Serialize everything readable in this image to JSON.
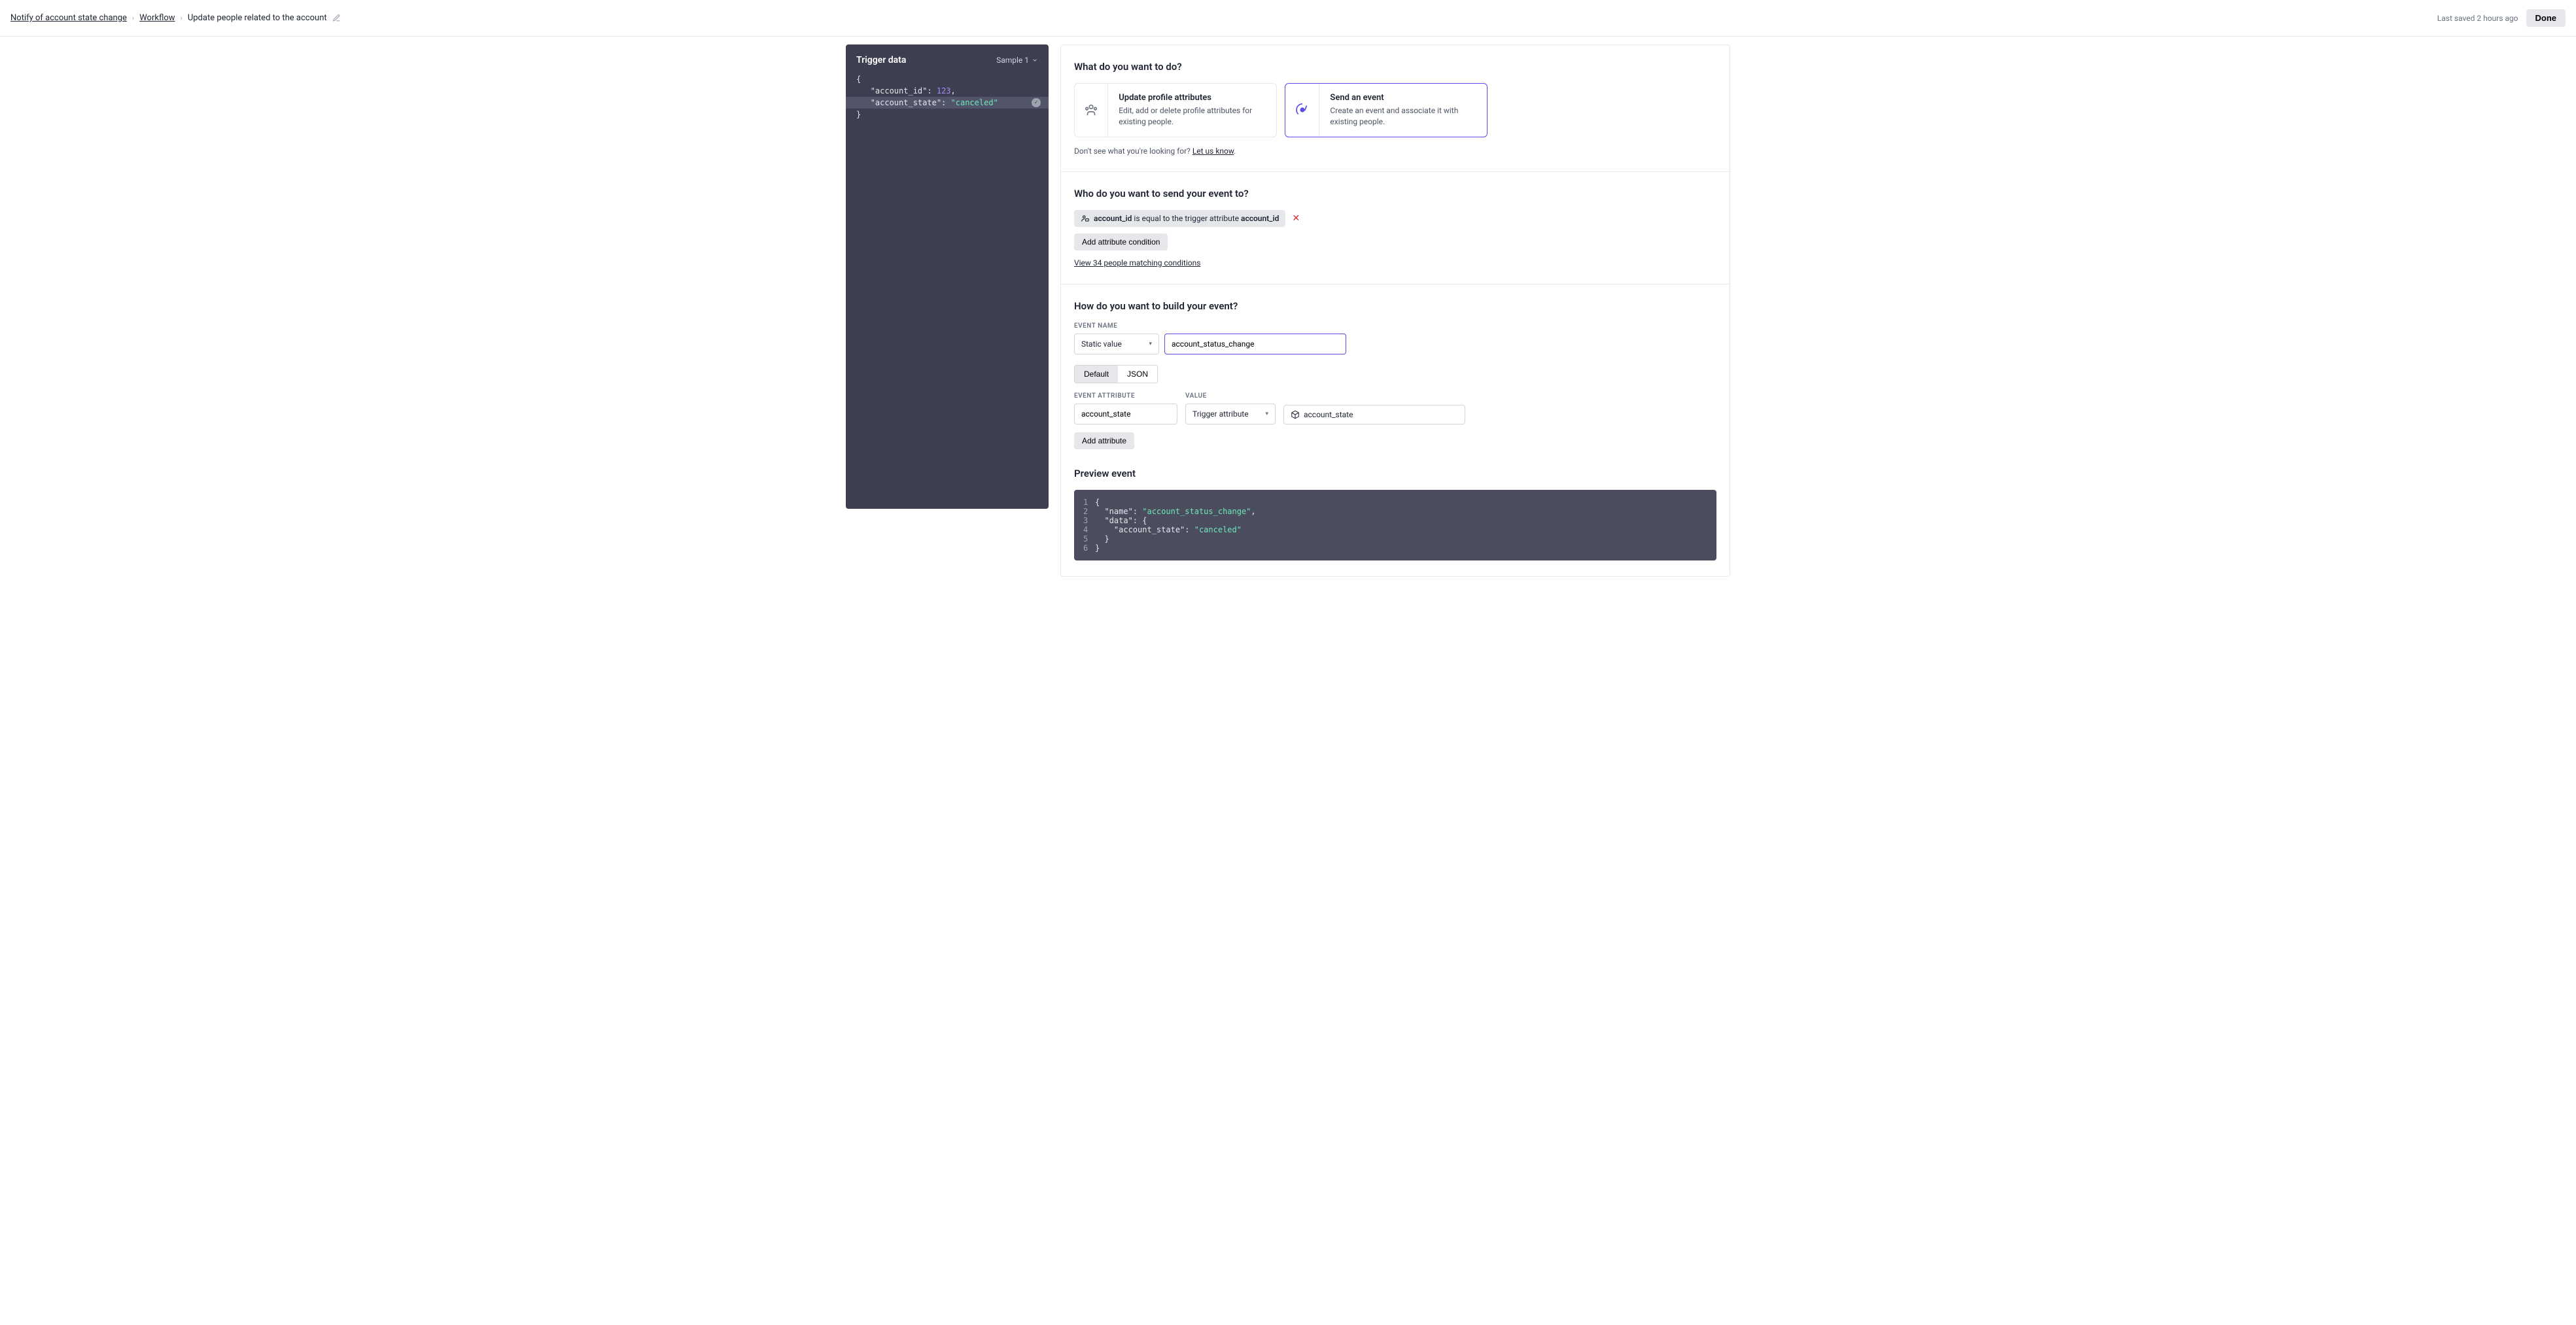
{
  "header": {
    "breadcrumb": [
      "Notify of account state change",
      "Workflow",
      "Update people related to the account"
    ],
    "saved": "Last saved 2 hours ago",
    "done": "Done"
  },
  "sidebar": {
    "title": "Trigger data",
    "sample": "Sample 1",
    "json": {
      "open": "{",
      "line1_key": "\"account_id\": ",
      "line1_val": "123",
      "line1_suffix": ",",
      "line2_key": "\"account_state\": ",
      "line2_val": "\"canceled\"",
      "close": "}"
    }
  },
  "section1": {
    "title": "What do you want to do?",
    "card1_title": "Update profile attributes",
    "card1_desc": "Edit, add or delete profile attributes for existing people.",
    "card2_title": "Send an event",
    "card2_desc": "Create an event and associate it with existing people.",
    "feedback_prefix": "Don't see what you're looking for? ",
    "feedback_link": "Let us know",
    "feedback_suffix": "."
  },
  "section2": {
    "title": "Who do you want to send your event to?",
    "chip_attr1": "account_id",
    "chip_mid": " is equal to the trigger attribute ",
    "chip_attr2": "account_id",
    "add_btn": "Add attribute condition",
    "view_link": "View 34 people matching conditions"
  },
  "section3": {
    "title": "How do you want to build your event?",
    "event_name_label": "EVENT NAME",
    "select_static": "Static value",
    "event_name_value": "account_status_change",
    "seg_default": "Default",
    "seg_json": "JSON",
    "event_attr_label": "EVENT ATTRIBUTE",
    "value_label": "VALUE",
    "attr_name": "account_state",
    "select_trigger": "Trigger attribute",
    "attr_value": "account_state",
    "add_attr_btn": "Add attribute",
    "preview_title": "Preview event",
    "preview": {
      "l1": "{",
      "l2_key": "  \"name\": ",
      "l2_val": "\"account_status_change\"",
      "l2_suffix": ",",
      "l3_key": "  \"data\": ",
      "l3_val": "{",
      "l4_key": "    \"account_state\": ",
      "l4_val": "\"canceled\"",
      "l5": "  }",
      "l6": "}"
    }
  }
}
